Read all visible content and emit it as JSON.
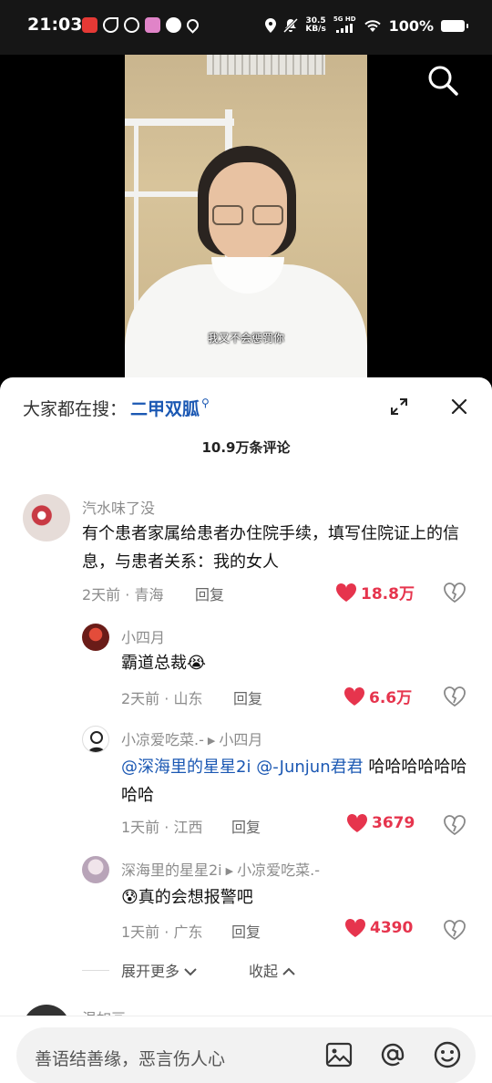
{
  "status_bar": {
    "time": "21:03",
    "speed_value": "30.5",
    "speed_unit": "KB/s",
    "network": "5G HD",
    "battery": "100%"
  },
  "video": {
    "caption": "我又不会惩罚你"
  },
  "sheet": {
    "trend_prefix": "大家都在搜：",
    "trend_keyword": "二甲双胍",
    "comment_count": "10.9万条评论"
  },
  "comments": [
    {
      "user": "汽水味了没",
      "text": "有个患者家属给患者办住院手续，填写住院证上的信息，与患者关系：我的女人",
      "meta": "2天前 · 青海",
      "reply": "回复",
      "likes": "18.8万"
    },
    {
      "user": "小四月",
      "text": "霸道总裁",
      "meta": "2天前 · 山东",
      "reply": "回复",
      "likes": "6.6万"
    },
    {
      "user": "小凉爱吃菜.-",
      "reply_to": "小四月",
      "mention1": "@深海里的星星2i",
      "mention2": "@-Junjun君君",
      "text": " 哈哈哈哈哈哈哈哈",
      "meta": "1天前 · 江西",
      "reply": "回复",
      "likes": "3679"
    },
    {
      "user": "深海里的星星2i",
      "reply_to": "小凉爱吃菜.-",
      "text": "真的会想报警吧",
      "meta": "1天前 · 广东",
      "reply": "回复",
      "likes": "4390"
    }
  ],
  "more": {
    "expand": "展开更多",
    "collapse": "收起"
  },
  "next_comment": {
    "user": "温如画"
  },
  "input": {
    "placeholder": "善语结善缘，恶言伤人心"
  },
  "colors": {
    "accent_link": "#1b58b3",
    "like_red": "#e6344d"
  }
}
